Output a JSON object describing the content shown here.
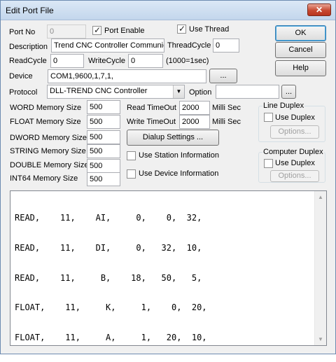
{
  "window": {
    "title": "Edit Port File",
    "close_glyph": "✕"
  },
  "port_no": {
    "label": "Port No",
    "value": "0"
  },
  "port_enable": {
    "label": "Port Enable",
    "checked": true
  },
  "use_thread": {
    "label": "Use Thread",
    "checked": true
  },
  "description": {
    "label": "Description",
    "value": "Trend CNC Controller Communica"
  },
  "thread_cycle": {
    "label": "ThreadCycle",
    "value": "0"
  },
  "read_cycle": {
    "label": "ReadCycle",
    "value": "0"
  },
  "write_cycle": {
    "label": "WriteCycle",
    "value": "0",
    "hint": "(1000=1sec)"
  },
  "device": {
    "label": "Device",
    "value": "COM1,9600,1,7,1,",
    "browse_label": "..."
  },
  "protocol": {
    "label": "Protocol",
    "value": "DLL-TREND CNC Controller",
    "arrow_glyph": "▼"
  },
  "option": {
    "label": "Option",
    "value": "",
    "browse_label": "..."
  },
  "memory": [
    {
      "label": "WORD Memory Size",
      "value": "500"
    },
    {
      "label": "FLOAT Memory Size",
      "value": "500"
    },
    {
      "label": "DWORD Memory Size",
      "value": "500"
    },
    {
      "label": "STRING Memory Size",
      "value": "500"
    },
    {
      "label": "DOUBLE Memory Size",
      "value": "500"
    },
    {
      "label": "INT64 Memory Size",
      "value": "500"
    }
  ],
  "read_timeout": {
    "label": "Read TimeOut",
    "value": "2000",
    "unit": "Milli Sec"
  },
  "write_timeout": {
    "label": "Write TimeOut",
    "value": "2000",
    "unit": "Milli Sec"
  },
  "dialup_button": "Dialup Settings ...",
  "use_station": {
    "label": "Use Station Information",
    "checked": false
  },
  "use_device": {
    "label": "Use Device Information",
    "checked": false
  },
  "buttons": {
    "ok": "OK",
    "cancel": "Cancel",
    "help": "Help"
  },
  "line_duplex": {
    "title": "Line Duplex",
    "checkbox_label": "Use Duplex",
    "checked": false,
    "options_label": "Options..."
  },
  "computer_duplex": {
    "title": "Computer Duplex",
    "checkbox_label": "Use Duplex",
    "checked": false,
    "options_label": "Options..."
  },
  "memo_lines": [
    "READ,    11,    AI,     0,    0,  32,",
    "READ,    11,    DI,     0,   32,  10,",
    "READ,    11,     B,    18,   50,   5,",
    "FLOAT,    11,     K,     1,    0,  20,",
    "FLOAT,    11,     A,     1,   20,  10,"
  ],
  "scroll": {
    "up_glyph": "▲",
    "down_glyph": "▼"
  }
}
